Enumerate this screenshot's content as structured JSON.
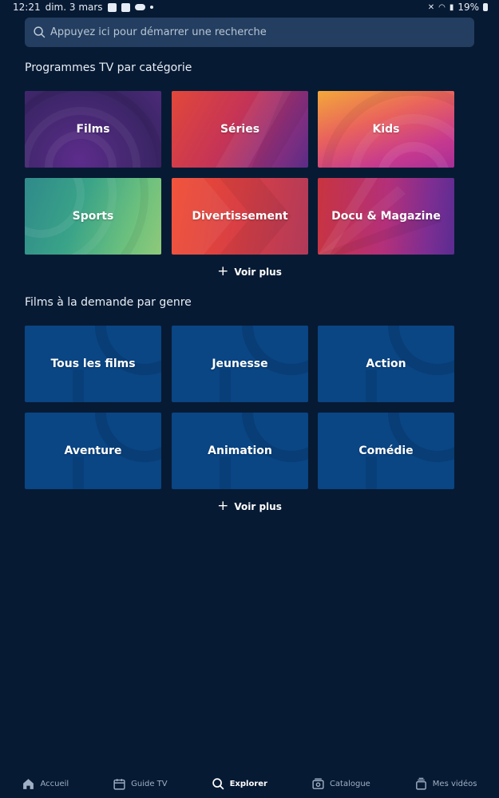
{
  "status_bar": {
    "time": "12:21",
    "date": "dim. 3 mars",
    "battery": "19%"
  },
  "search": {
    "placeholder": "Appuyez ici pour démarrer une recherche"
  },
  "sections": {
    "tv": {
      "title": "Programmes TV par catégorie",
      "tiles": [
        "Films",
        "Séries",
        "Kids",
        "Sports",
        "Divertissement",
        "Docu & Magazine"
      ],
      "more": "Voir plus"
    },
    "vod": {
      "title": "Films à la demande par genre",
      "tiles": [
        "Tous les films",
        "Jeunesse",
        "Action",
        "Aventure",
        "Animation",
        "Comédie"
      ],
      "more": "Voir plus"
    }
  },
  "bottom_nav": {
    "items": [
      {
        "label": "Accueil",
        "icon": "home-icon"
      },
      {
        "label": "Guide TV",
        "icon": "calendar-icon"
      },
      {
        "label": "Explorer",
        "icon": "search-icon"
      },
      {
        "label": "Catalogue",
        "icon": "catalogue-icon"
      },
      {
        "label": "Mes vidéos",
        "icon": "my-videos-icon"
      }
    ],
    "active": "Explorer"
  },
  "colors": {
    "background": "#071a33",
    "search_bg": "#233e60",
    "genre_tile": "#0a4584"
  }
}
